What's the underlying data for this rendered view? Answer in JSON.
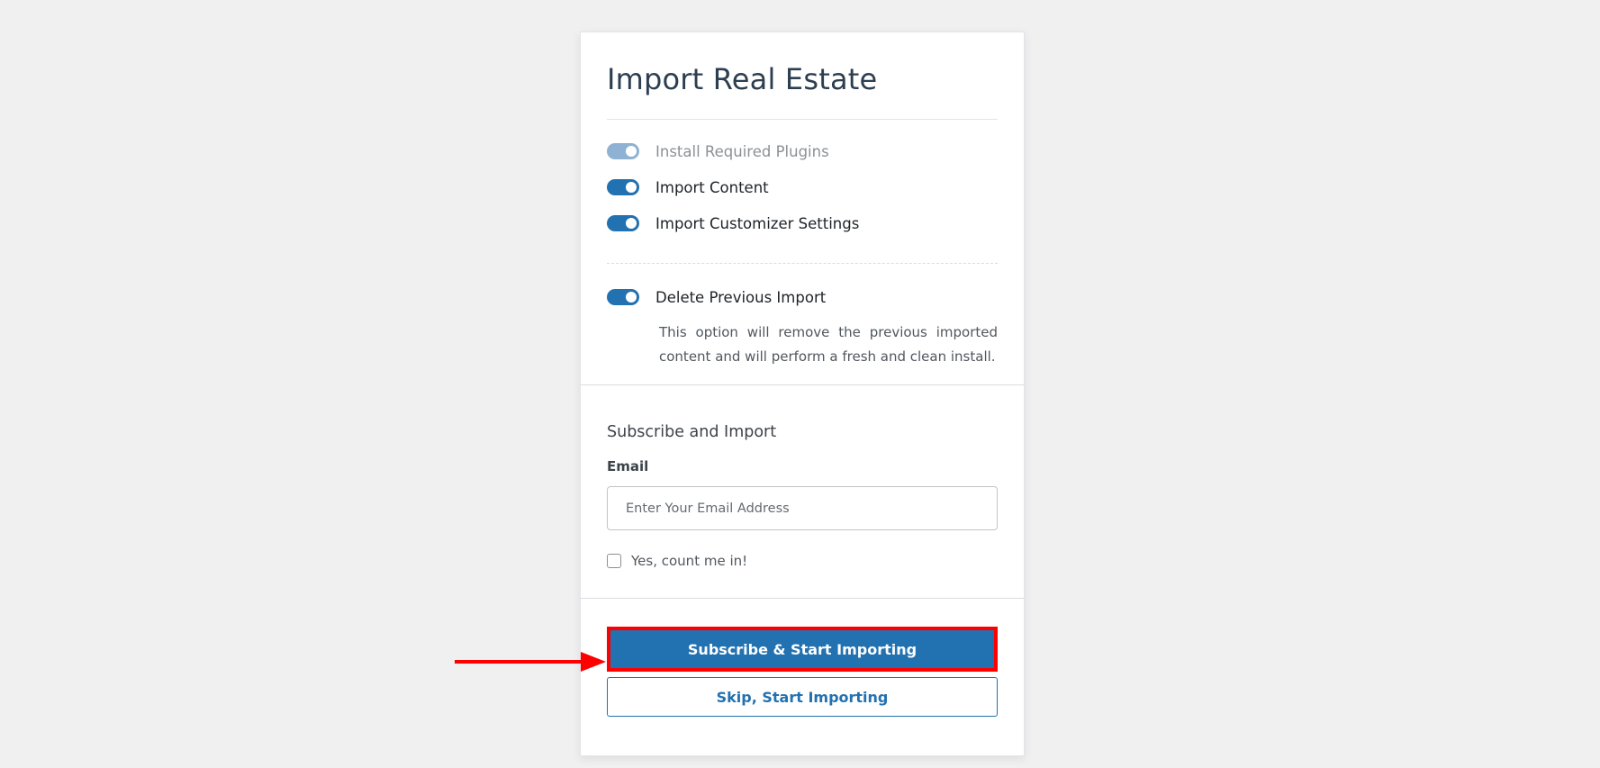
{
  "header": {
    "title": "Import Real Estate"
  },
  "options": [
    {
      "label": "Install Required Plugins",
      "enabled": true,
      "disabled": true
    },
    {
      "label": "Import Content",
      "enabled": true,
      "disabled": false
    },
    {
      "label": "Import Customizer Settings",
      "enabled": true,
      "disabled": false
    }
  ],
  "delete_option": {
    "label": "Delete Previous Import",
    "enabled": true,
    "description": "This option will remove the previous imported content and will perform a fresh and clean install."
  },
  "subscribe": {
    "title": "Subscribe and Import",
    "email_label": "Email",
    "email_placeholder": "Enter Your Email Address",
    "email_value": "",
    "checkbox_label": "Yes, count me in!",
    "checkbox_checked": false
  },
  "actions": {
    "primary_label": "Subscribe & Start Importing",
    "secondary_label": "Skip, Start Importing"
  },
  "colors": {
    "accent": "#2271b1",
    "toggle_disabled": "#8fb2d4",
    "highlight": "#ff0000",
    "background": "#f0f0f1"
  },
  "annotation": {
    "icon": "red-arrow-right-icon"
  }
}
